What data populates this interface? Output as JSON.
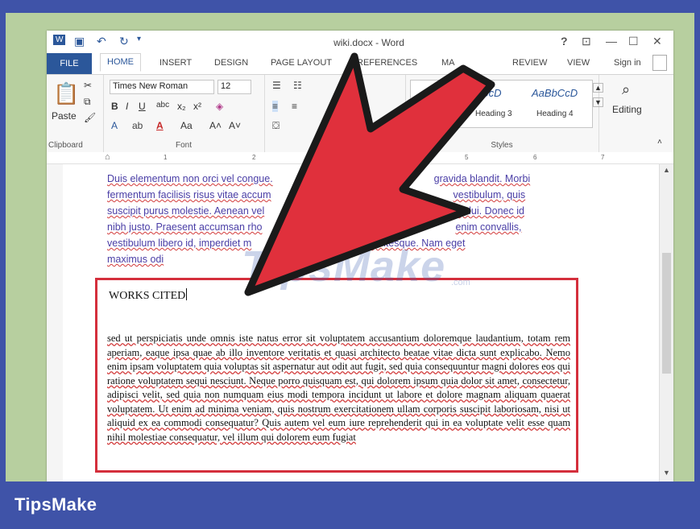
{
  "window": {
    "title": "wiki.docx - Word",
    "controls": {
      "help": "?",
      "restore_ribbon": "⊡",
      "minimize": "—",
      "maximize": "☐",
      "close": "✕"
    }
  },
  "tabs": [
    {
      "label": "FILE"
    },
    {
      "label": "HOME"
    },
    {
      "label": "INSERT"
    },
    {
      "label": "DESIGN"
    },
    {
      "label": "PAGE LAYOUT"
    },
    {
      "label": "REFERENCES"
    },
    {
      "label": "MA"
    },
    {
      "label": "REVIEW"
    },
    {
      "label": "VIEW"
    }
  ],
  "sign_in": "Sign in",
  "ribbon": {
    "clipboard": {
      "paste_label": "Paste",
      "group_label": "Clipboard"
    },
    "font": {
      "font_name": "Times New Roman",
      "font_size": "12",
      "group_label": "Font"
    },
    "styles": {
      "previews": [
        "bCcD",
        "AaBbCcD"
      ],
      "names": [
        "Heading 3",
        "Heading 4"
      ],
      "group_label": "Styles"
    },
    "editing": {
      "label": "Editing"
    }
  },
  "ruler": {
    "numbers": [
      "1",
      "2",
      "5",
      "6",
      "7"
    ]
  },
  "document": {
    "lorem_lines": [
      "Duis elementum non orci vel congue.",
      "gravida blandit. Morbi",
      "fermentum facilisis risus vitae accum",
      "vestibulum, quis",
      "suscipit purus molestie. Aenean vel",
      "s dui. Donec id",
      "nibh justo. Praesent accumsan rho",
      "enim convallis,",
      "vestibulum libero id, imperdiet m",
      "id pellentesque. Nam eget",
      "maximus odi"
    ],
    "works_cited_title": "WORKS CITED",
    "works_cited_body": "sed ut perspiciatis unde omnis iste natus error sit voluptatem accusantium doloremque laudantium, totam rem aperiam, eaque ipsa quae ab illo inventore veritatis et quasi architecto beatae vitae dicta sunt explicabo. Nemo enim ipsam voluptatem quia voluptas sit aspernatur aut odit aut fugit, sed quia consequuntur magni dolores eos qui ratione voluptatem sequi nesciunt. Neque porro quisquam est, qui dolorem ipsum quia dolor sit amet, consectetur, adipisci velit, sed quia non numquam eius modi tempora incidunt ut labore et dolore magnam aliquam quaerat voluptatem. Ut enim ad minima veniam, quis nostrum exercitationem ullam corporis suscipit laboriosam, nisi ut aliquid ex ea commodi consequatur? Quis autem vel eum iure reprehenderit qui in ea voluptate velit esse quam nihil molestiae consequatur, vel illum qui dolorem eum fugiat"
  },
  "watermark": {
    "text": "TipsMake",
    "tail": ".com"
  },
  "brand": "TipsMake",
  "colors": {
    "word_blue": "#2b579a",
    "highlight_red": "#d42f3c",
    "arrow_red": "#e0303c",
    "frame_blue": "#3f53a8",
    "frame_green": "#b7cf9f"
  }
}
